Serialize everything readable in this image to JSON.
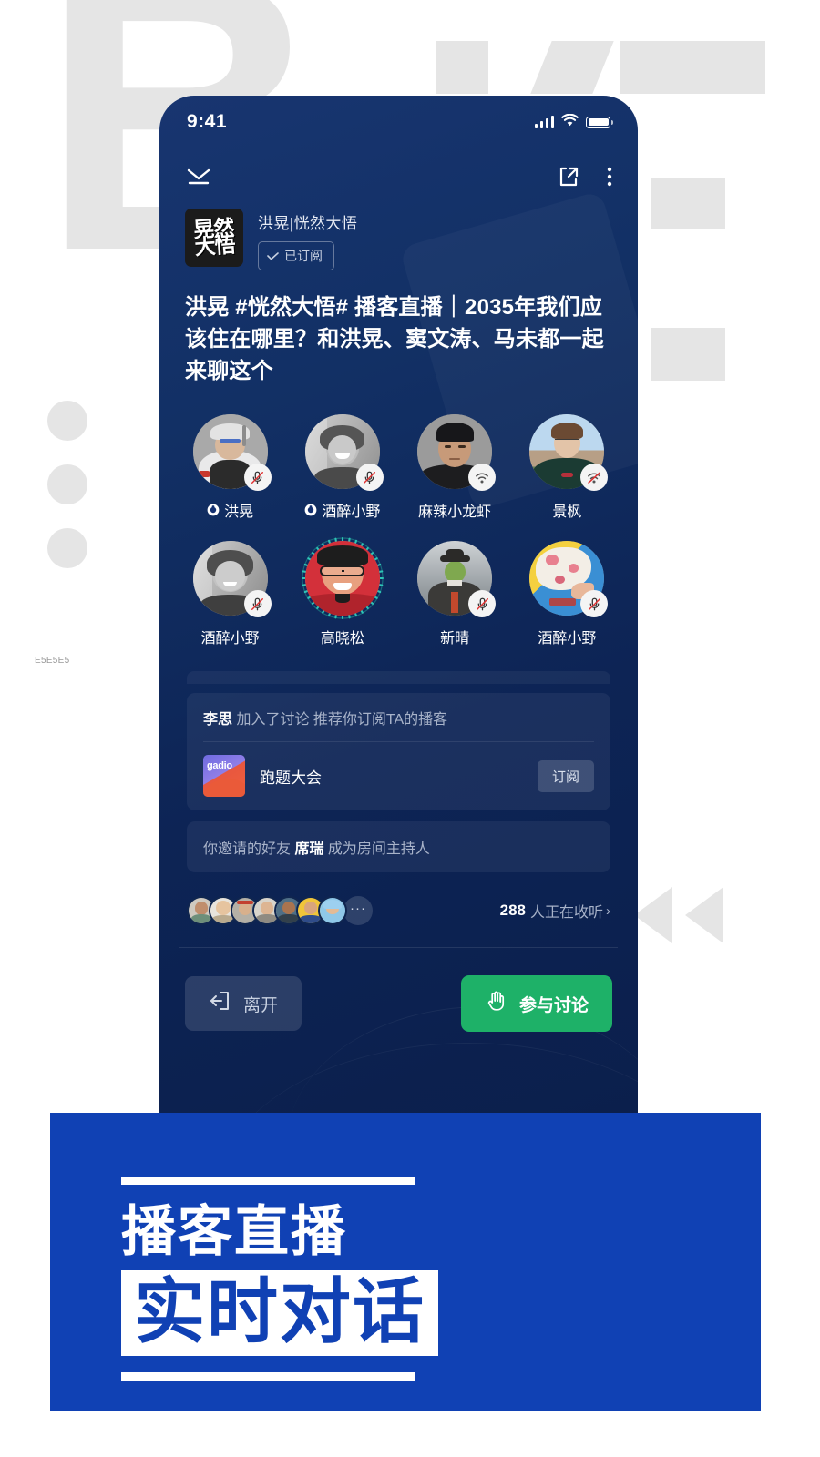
{
  "background": {
    "letter": "B",
    "hex_label": "E5E5E5",
    "accent_gray": "#E5E5E5"
  },
  "phone": {
    "status_bar": {
      "time": "9:41",
      "signal_icon": "cellular-signal-icon",
      "wifi_icon": "wifi-icon",
      "battery_icon": "battery-full-icon"
    },
    "nav": {
      "collapse_icon": "chevron-down-underline-icon",
      "share_icon": "share-external-icon",
      "more_icon": "more-vertical-icon"
    },
    "channel": {
      "logo_text": "晃然\n大悟",
      "name": "洪晃|恍然大悟",
      "subscribe_label": "已订阅",
      "subscribe_check_icon": "check-icon"
    },
    "room_title": "洪晃 #恍然大悟# 播客直播｜2035年我们应该住在哪里？和洪晃、窦文涛、马未都一起来聊这个",
    "speakers": [
      {
        "name": "洪晃",
        "badge": "mic-muted-icon",
        "host": true,
        "speaking": false
      },
      {
        "name": "酒醉小野",
        "badge": "mic-muted-icon",
        "host": true,
        "speaking": false
      },
      {
        "name": "麻辣小龙虾",
        "badge": "wifi-icon",
        "host": false,
        "speaking": false
      },
      {
        "name": "景枫",
        "badge": "wifi-off-icon",
        "host": false,
        "speaking": false
      },
      {
        "name": "酒醉小野",
        "badge": "mic-muted-icon",
        "host": false,
        "speaking": false
      },
      {
        "name": "高晓松",
        "badge": "",
        "host": false,
        "speaking": true
      },
      {
        "name": "新晴",
        "badge": "mic-muted-icon",
        "host": false,
        "speaking": false
      },
      {
        "name": "酒醉小野",
        "badge": "mic-muted-icon",
        "host": false,
        "speaking": false
      }
    ],
    "notices": [
      {
        "user": "李思",
        "text": "加入了讨论  推荐你订阅TA的播客",
        "podcast": {
          "cover_label": "gadio",
          "name": "跑题大会",
          "button": "订阅"
        }
      },
      {
        "prefix": "你邀请的好友 ",
        "user": "席瑞",
        "suffix": " 成为房间主持人"
      }
    ],
    "listeners": {
      "avatar_count": 7,
      "more_icon": "ellipsis-icon",
      "count": "288",
      "label": "人正在收听",
      "chevron_icon": "chevron-right-icon"
    },
    "actions": {
      "leave": {
        "label": "离开",
        "icon": "exit-door-icon"
      },
      "join": {
        "label": "参与讨论",
        "icon": "raised-hand-icon",
        "color": "#1EB168"
      }
    }
  },
  "banner": {
    "line1": "播客直播",
    "line2": "实时对话",
    "bg_color": "#1041B4"
  }
}
